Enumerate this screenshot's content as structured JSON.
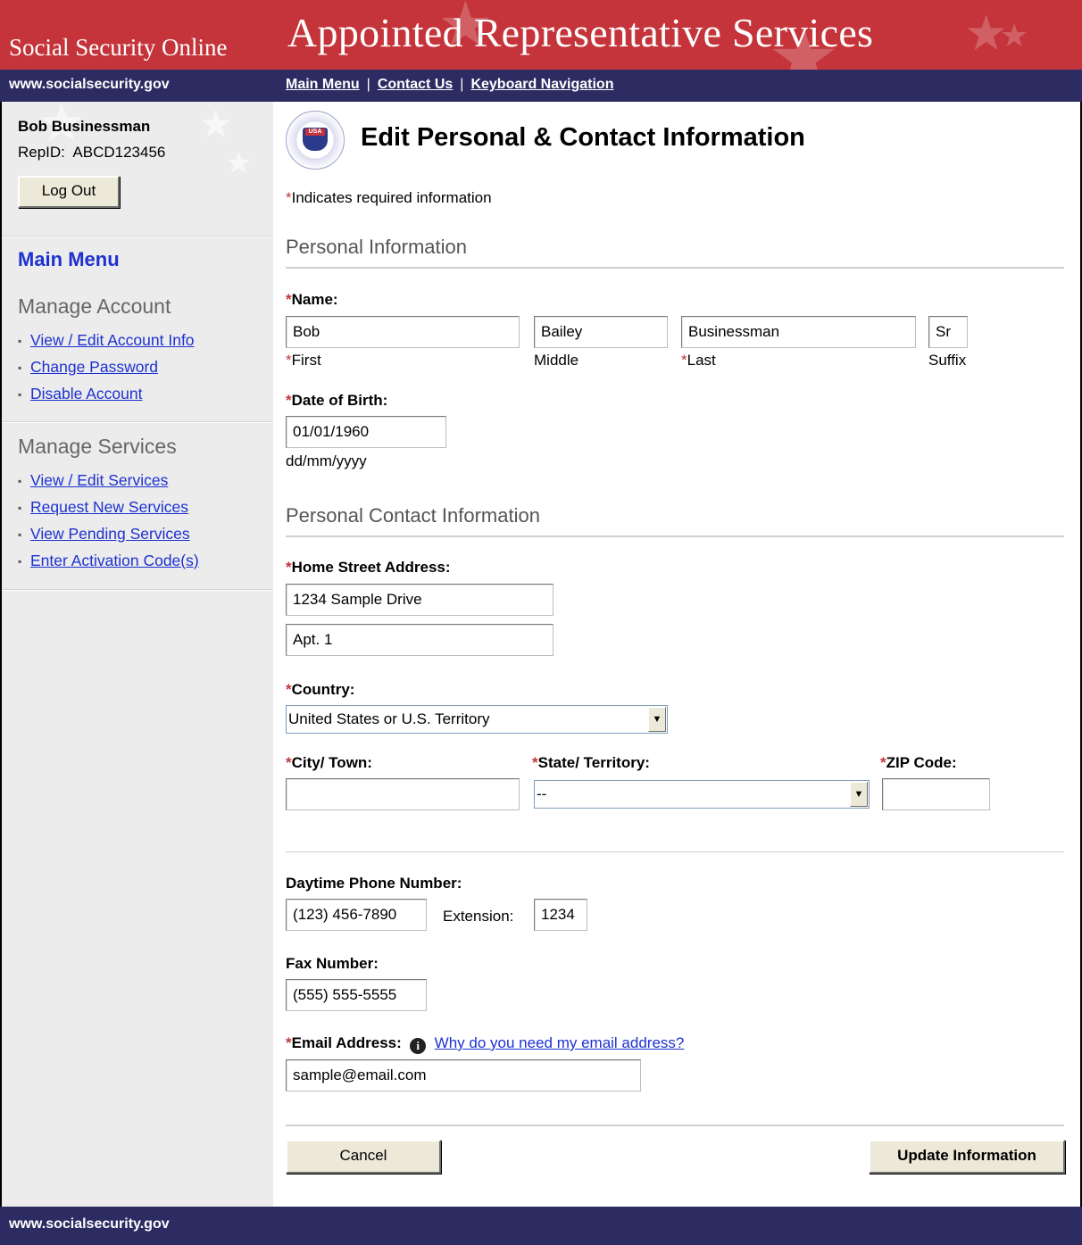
{
  "header": {
    "brand": "Social Security Online",
    "app_title": "Appointed Representative Services",
    "site_url": "www.socialsecurity.gov",
    "links": [
      "Main Menu",
      "Contact Us",
      "Keyboard Navigation"
    ],
    "colors": {
      "header_red": "#c4343a",
      "nav_navy": "#2d2c62",
      "link_blue": "#1d31d0"
    }
  },
  "user": {
    "name": "Bob Businessman",
    "rep_id": "RepID:  ABCD123456",
    "logout_label": "Log Out"
  },
  "sidebar": {
    "main_menu": "Main Menu",
    "manage_account": {
      "title": "Manage Account",
      "items": [
        "View / Edit Account Info",
        "Change Password",
        "Disable Account"
      ]
    },
    "manage_services": {
      "title": "Manage Services",
      "items": [
        "View / Edit Services",
        "Request New Services",
        "View Pending Services",
        "Enter Activation Code(s)"
      ]
    }
  },
  "page": {
    "seal_text": "USA",
    "title": "Edit Personal & Contact Information",
    "required_note_star": "*",
    "required_note": "Indicates required information"
  },
  "personal": {
    "heading": "Personal Information",
    "name_label": "Name:",
    "first": {
      "value": "Bob",
      "caption": "First"
    },
    "middle": {
      "value": "Bailey",
      "caption": "Middle"
    },
    "last": {
      "value": "Businessman",
      "caption": "Last"
    },
    "suffix": {
      "value": "Sr",
      "caption": "Suffix"
    },
    "dob_label": "Date of Birth:",
    "dob_value": "01/01/1960",
    "dob_format": "dd/mm/yyyy"
  },
  "contact": {
    "heading": "Personal Contact Information",
    "address_label": "Home Street Address:",
    "address1": "1234 Sample Drive",
    "address2": "Apt. 1",
    "country_label": "Country:",
    "country_value": "United States or U.S. Territory",
    "city_label": "City/ Town:",
    "city_value": "",
    "state_label": "State/ Territory:",
    "state_value": "--",
    "zip_label": "ZIP Code:",
    "zip_value": "",
    "phone_label": "Daytime Phone Number:",
    "phone_value": "(123) 456-7890",
    "extension_label": "Extension:",
    "extension_value": "1234",
    "fax_label": "Fax Number:",
    "fax_value": "(555) 555-5555",
    "email_label": "Email Address:",
    "email_help_link": "Why do you need my email address?",
    "email_value": "sample@email.com"
  },
  "actions": {
    "cancel": "Cancel",
    "update": "Update Information"
  },
  "footer": {
    "site_url": "www.socialsecurity.gov"
  }
}
